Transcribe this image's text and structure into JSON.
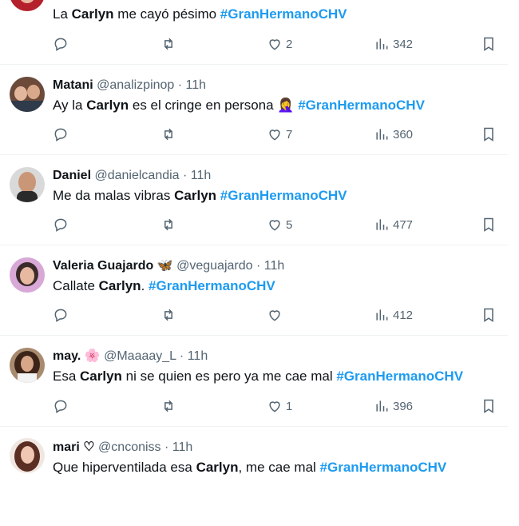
{
  "tweets": [
    {
      "name": "",
      "handle": "",
      "time": "",
      "pre": "La ",
      "bold": "Carlyn",
      "post": " me cayó pésimo ",
      "hashtag": "#GranHermanoCHV",
      "replies": "",
      "retweets": "",
      "likes": "2",
      "views": "342"
    },
    {
      "name": "Matani",
      "handle": "@analizpinop",
      "time": "11h",
      "pre": "Ay la ",
      "bold": "Carlyn",
      "post": " es el cringe en persona 🤦‍♀️ ",
      "hashtag": "#GranHermanoCHV",
      "replies": "",
      "retweets": "",
      "likes": "7",
      "views": "360"
    },
    {
      "name": "Daniel",
      "handle": "@danielcandia",
      "time": "11h",
      "pre": "Me da malas vibras ",
      "bold": "Carlyn",
      "post": "  ",
      "hashtag": "#GranHermanoCHV",
      "replies": "",
      "retweets": "",
      "likes": "5",
      "views": "477"
    },
    {
      "name": "Valeria Guajardo 🦋",
      "handle": "@veguajardo",
      "time": "11h",
      "pre": "Callate ",
      "bold": "Carlyn",
      "post": ". ",
      "hashtag": "#GranHermanoCHV",
      "replies": "",
      "retweets": "",
      "likes": "",
      "views": "412"
    },
    {
      "name": "may. 🌸",
      "handle": "@Maaaay_L",
      "time": "11h",
      "pre": "Esa ",
      "bold": "Carlyn",
      "post": " ni se quien es pero ya me cae mal ",
      "hashtag": "#GranHermanoCHV",
      "replies": "",
      "retweets": "",
      "likes": "1",
      "views": "396"
    },
    {
      "name": "mari ♡",
      "handle": "@cnconiss",
      "time": "11h",
      "pre": "Que hiperventilada esa ",
      "bold": "Carlyn",
      "post": ", me cae mal ",
      "hashtag": "#GranHermanoCHV",
      "replies": "",
      "retweets": "",
      "likes": "",
      "views": ""
    }
  ],
  "meta_separator": " · ",
  "colors": {
    "hashtag": "#1d9bf0",
    "secondary_text": "#536471",
    "divider": "#eff3f4"
  },
  "icons": [
    "reply-icon",
    "retweet-icon",
    "like-icon",
    "views-icon",
    "bookmark-icon"
  ]
}
